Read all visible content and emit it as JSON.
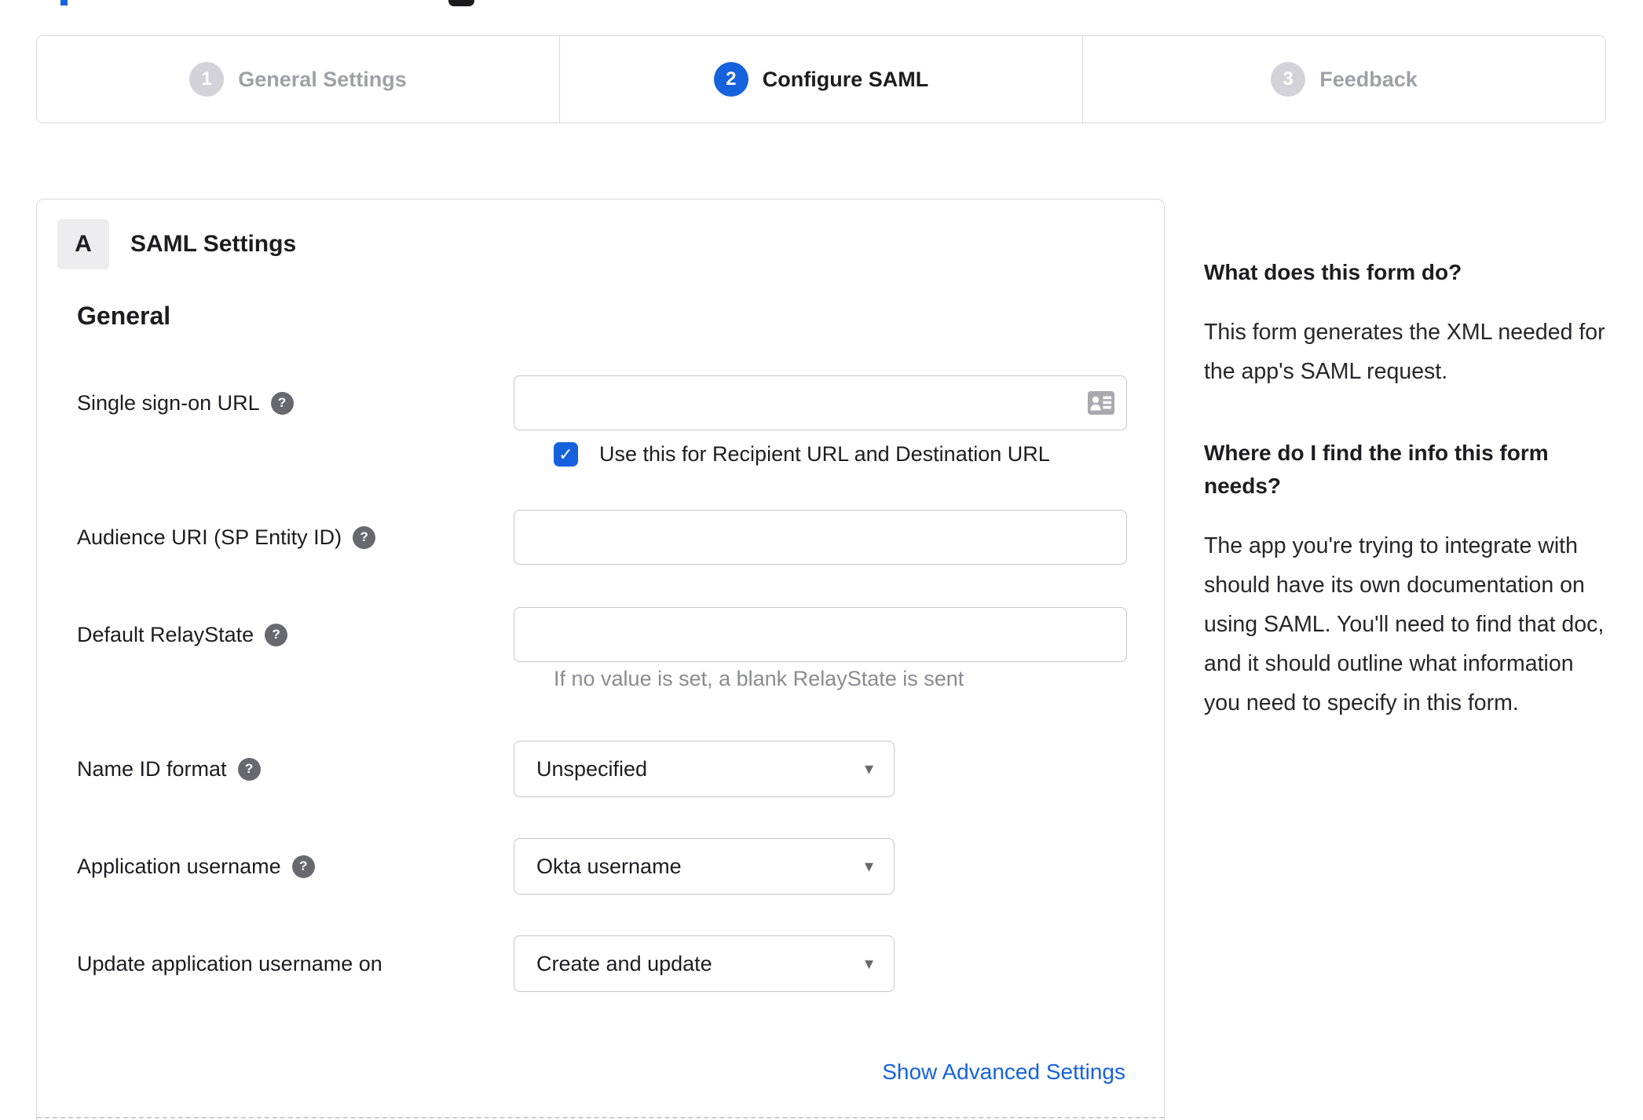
{
  "accent_color": "#1662dd",
  "icons": {
    "help": "?",
    "check": "✓",
    "caret": "▾"
  },
  "stepper": {
    "steps": [
      {
        "number": "1",
        "label": "General Settings",
        "state": "inactive"
      },
      {
        "number": "2",
        "label": "Configure SAML",
        "state": "active"
      },
      {
        "number": "3",
        "label": "Feedback",
        "state": "inactive"
      }
    ]
  },
  "panel": {
    "section_badge": "A",
    "section_title": "SAML Settings",
    "group_heading": "General",
    "fields": [
      {
        "label": "Single sign-on URL",
        "type": "text",
        "value": "",
        "has_help": true,
        "checkbox_checked": true,
        "checkbox_label": "Use this for Recipient URL and Destination URL"
      },
      {
        "label": "Audience URI (SP Entity ID)",
        "type": "text",
        "value": "",
        "has_help": true
      },
      {
        "label": "Default RelayState",
        "type": "text",
        "value": "",
        "has_help": true,
        "helper": "If no value is set, a blank RelayState is sent"
      },
      {
        "label": "Name ID format",
        "type": "select",
        "value": "Unspecified",
        "has_help": true
      },
      {
        "label": "Application username",
        "type": "select",
        "value": "Okta username",
        "has_help": true
      },
      {
        "label": "Update application username on",
        "type": "select",
        "value": "Create and update",
        "has_help": false
      }
    ],
    "advanced_link": "Show Advanced Settings"
  },
  "sidebar": {
    "heading1": "What does this form do?",
    "para1": "This form generates the XML needed for the app's SAML request.",
    "heading2": "Where do I find the info this form needs?",
    "para2": "The app you're trying to integrate with should have its own documentation on using SAML. You'll need to find that doc, and it should outline what information you need to specify in this form."
  }
}
